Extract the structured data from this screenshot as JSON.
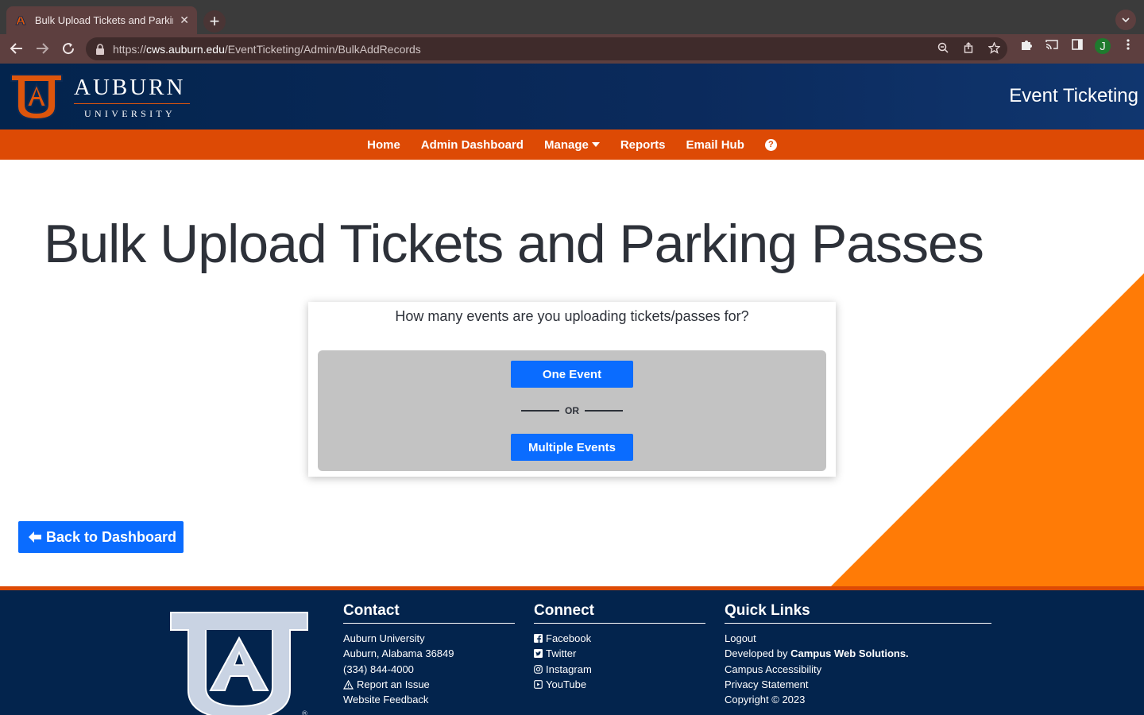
{
  "browser": {
    "tab_title": "Bulk Upload Tickets and Parking Passes",
    "tab_close": "✕",
    "new_tab": "+",
    "url_scheme": "https://",
    "url_host": "cws.auburn.edu",
    "url_path": "/EventTicketing/Admin/BulkAddRecords",
    "profile_initial": "J"
  },
  "header": {
    "logo_line1": "AUBURN",
    "logo_line2": "UNIVERSITY",
    "site_name": "Event Ticketing"
  },
  "nav": {
    "home": "Home",
    "admin_dashboard": "Admin Dashboard",
    "manage": "Manage",
    "reports": "Reports",
    "email_hub": "Email Hub",
    "help": "?"
  },
  "main": {
    "title": "Bulk Upload Tickets and Parking Passes",
    "question": "How many events are you uploading tickets/passes for?",
    "one_event": "One Event",
    "or": "OR",
    "multiple_events": "Multiple Events",
    "back": "Back to Dashboard"
  },
  "footer": {
    "contact": {
      "heading": "Contact",
      "name": "Auburn University",
      "address": "Auburn, Alabama 36849",
      "phone": "(334) 844-4000",
      "report": "Report an Issue",
      "feedback": "Website Feedback"
    },
    "connect": {
      "heading": "Connect",
      "facebook": "Facebook",
      "twitter": "Twitter",
      "instagram": "Instagram",
      "youtube": "YouTube"
    },
    "quick_links": {
      "heading": "Quick Links",
      "logout": "Logout",
      "developed_prefix": "Developed by ",
      "developed_by": "Campus Web Solutions.",
      "accessibility": "Campus Accessibility",
      "privacy": "Privacy Statement",
      "copyright": "Copyright © 2023"
    }
  },
  "colors": {
    "navy": "#03244d",
    "orange": "#dd4a05",
    "triangle_orange": "#ff7b06",
    "button_blue": "#0a6cff"
  }
}
